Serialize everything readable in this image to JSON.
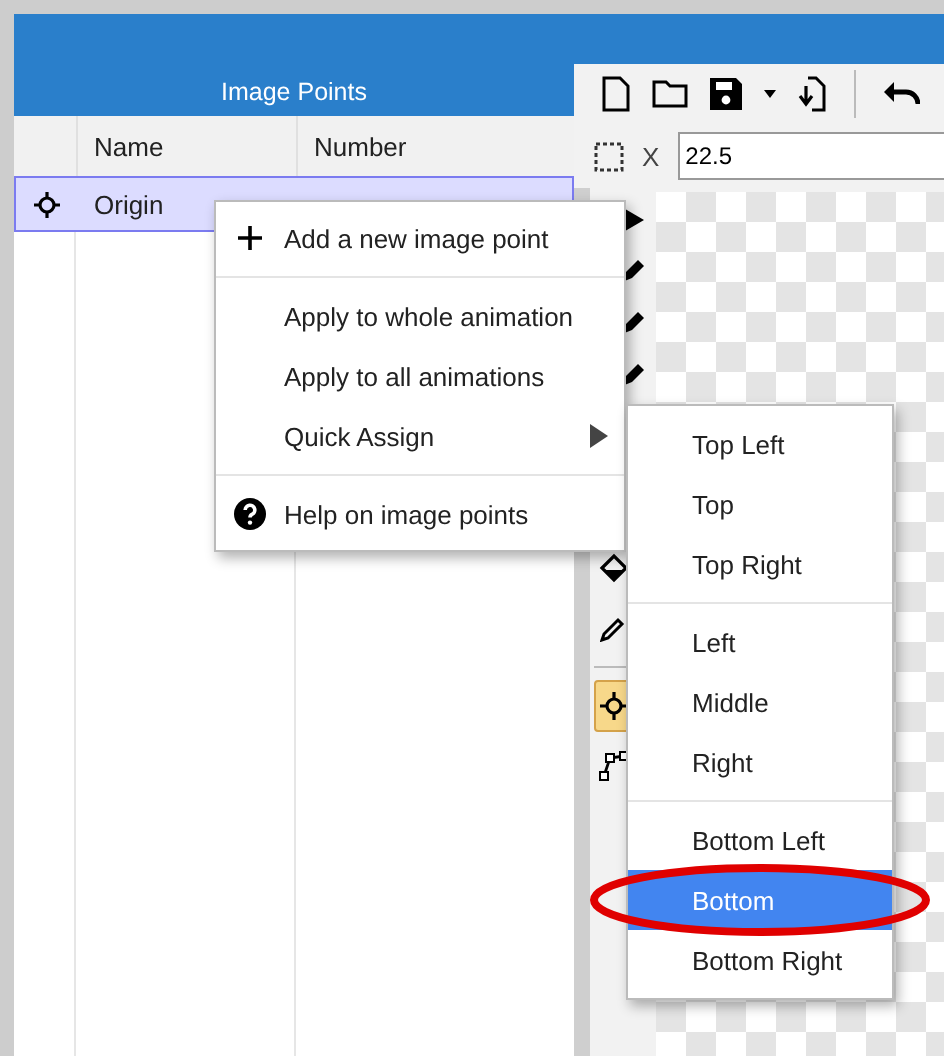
{
  "panel": {
    "title": "Image Points"
  },
  "table": {
    "columns": [
      "Name",
      "Number"
    ],
    "rows": [
      {
        "name": "Origin",
        "selected": true
      }
    ]
  },
  "toolbar": {
    "x_label": "X",
    "x_value": "22.5"
  },
  "tools": [
    {
      "kind": "arrow",
      "selected": false
    },
    {
      "kind": "pencil",
      "selected": false
    },
    {
      "kind": "pencil",
      "selected": false
    },
    {
      "kind": "pencil",
      "selected": false
    },
    {
      "kind": "fill",
      "selected": false
    },
    {
      "kind": "eyedropper",
      "selected": false
    },
    {
      "kind": "divider"
    },
    {
      "kind": "point",
      "selected": true
    },
    {
      "kind": "polyline",
      "selected": false
    }
  ],
  "context_menu": {
    "items": [
      {
        "kind": "add",
        "label": "Add a new image point"
      },
      {
        "kind": "separator"
      },
      {
        "kind": "plain",
        "label": "Apply to whole animation"
      },
      {
        "kind": "plain",
        "label": "Apply to all animations"
      },
      {
        "kind": "submenu",
        "label": "Quick Assign"
      },
      {
        "kind": "separator"
      },
      {
        "kind": "help",
        "label": "Help on image points"
      }
    ]
  },
  "submenu": {
    "items": [
      {
        "kind": "item",
        "label": "Top Left",
        "selected": false
      },
      {
        "kind": "item",
        "label": "Top",
        "selected": false
      },
      {
        "kind": "item",
        "label": "Top Right",
        "selected": false
      },
      {
        "kind": "separator"
      },
      {
        "kind": "item",
        "label": "Left",
        "selected": false
      },
      {
        "kind": "item",
        "label": "Middle",
        "selected": false
      },
      {
        "kind": "item",
        "label": "Right",
        "selected": false
      },
      {
        "kind": "separator"
      },
      {
        "kind": "item",
        "label": "Bottom Left",
        "selected": false
      },
      {
        "kind": "item",
        "label": "Bottom",
        "selected": true
      },
      {
        "kind": "item",
        "label": "Bottom Right",
        "selected": false
      }
    ]
  },
  "annotation": {
    "kind": "ellipse"
  }
}
